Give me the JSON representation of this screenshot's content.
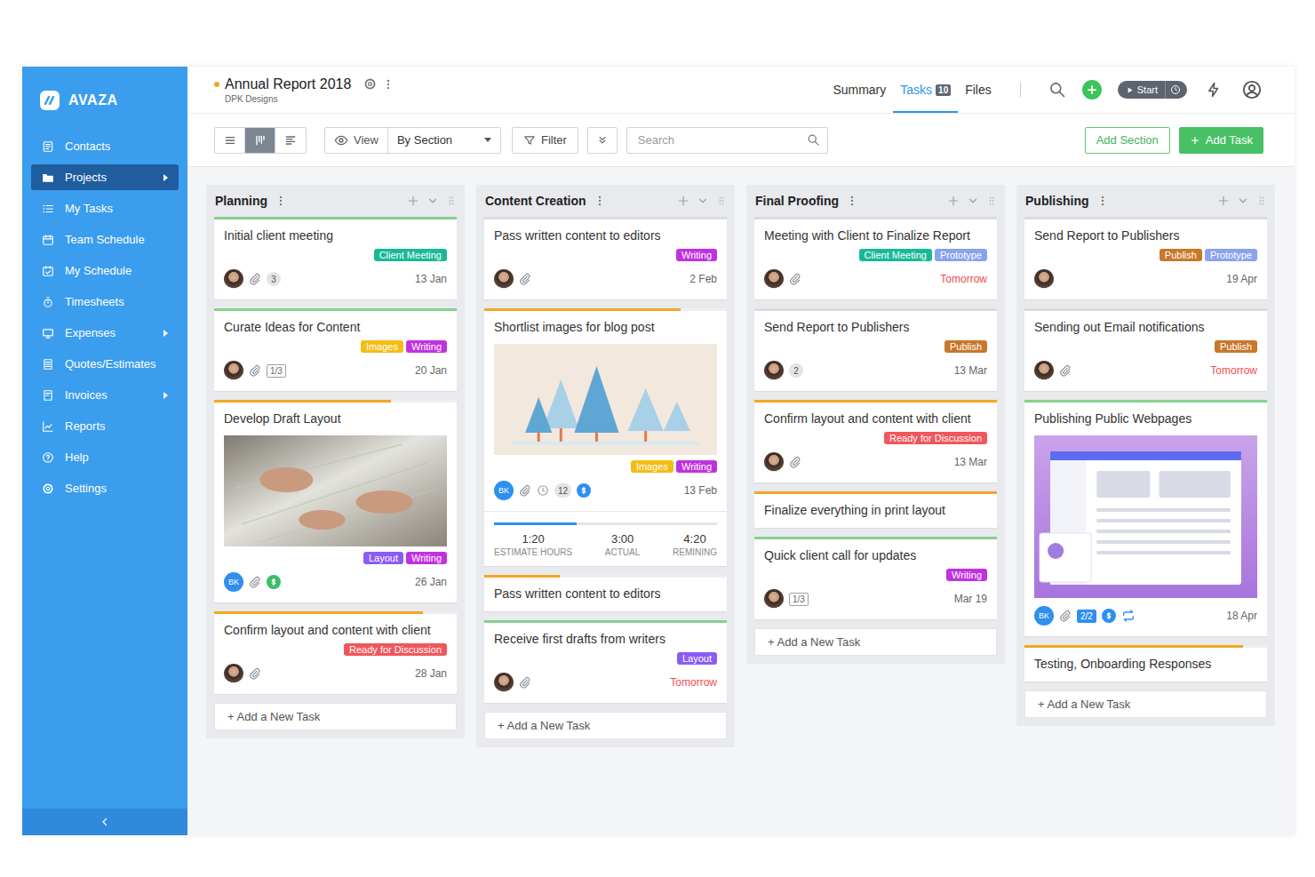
{
  "app": {
    "logo": "AVAZA"
  },
  "sidebar": {
    "items": [
      {
        "label": "Contacts",
        "selected": false,
        "has_submenu": false
      },
      {
        "label": "Projects",
        "selected": true,
        "has_submenu": true
      },
      {
        "label": "My Tasks",
        "selected": false,
        "has_submenu": false
      },
      {
        "label": "Team Schedule",
        "selected": false,
        "has_submenu": false
      },
      {
        "label": "My Schedule",
        "selected": false,
        "has_submenu": false
      },
      {
        "label": "Timesheets",
        "selected": false,
        "has_submenu": false
      },
      {
        "label": "Expenses",
        "selected": false,
        "has_submenu": true
      },
      {
        "label": "Quotes/Estimates",
        "selected": false,
        "has_submenu": false
      },
      {
        "label": "Invoices",
        "selected": false,
        "has_submenu": true
      },
      {
        "label": "Reports",
        "selected": false,
        "has_submenu": false
      },
      {
        "label": "Help",
        "selected": false,
        "has_submenu": false
      },
      {
        "label": "Settings",
        "selected": false,
        "has_submenu": false
      }
    ]
  },
  "project": {
    "title": "Annual Report 2018",
    "client": "DPK Designs",
    "status_color": "#f5a623"
  },
  "nav_tabs": [
    {
      "label": "Summary",
      "selected": false
    },
    {
      "label": "Tasks",
      "badge": "10",
      "selected": true
    },
    {
      "label": "Files",
      "selected": false
    }
  ],
  "timer": {
    "label": "Start"
  },
  "toolbar": {
    "view_modes": [
      {
        "selected": false
      },
      {
        "selected": true
      },
      {
        "selected": false
      }
    ],
    "view_label": "View",
    "group_by": "By Section",
    "filter": "Filter",
    "search_placeholder": "Search",
    "add_section": "Add Section",
    "add_task": "Add Task"
  },
  "columns": [
    {
      "title": "Planning",
      "add_task": "+ Add a New Task",
      "cards": [
        {
          "title": "Initial client meeting",
          "bar": {
            "color": "#86d08e",
            "level": 1
          },
          "tags": [
            {
              "label": "Client Meeting",
              "color": "#19b997"
            }
          ],
          "footer": {
            "avatar": {
              "kind": "photo"
            },
            "icons": [
              {
                "kind": "attachment"
              },
              {
                "kind": "count",
                "text": "3"
              }
            ],
            "date": {
              "text": "13 Jan",
              "color": "#666666"
            }
          }
        },
        {
          "title": "Curate Ideas for Content",
          "bar": {
            "color": "#86d08e",
            "level": 1
          },
          "tags": [
            {
              "label": "Images",
              "color": "#f5bd13"
            },
            {
              "label": "Writing",
              "color": "#c131e0"
            }
          ],
          "footer": {
            "avatar": {
              "kind": "photo"
            },
            "icons": [
              {
                "kind": "attachment"
              },
              {
                "kind": "checklist",
                "text": "1/3",
                "complete": false
              }
            ],
            "date": {
              "text": "20 Jan",
              "color": "#666666"
            }
          }
        },
        {
          "title": "Develop Draft Layout",
          "bar": {
            "color": "#f5a623",
            "level": 0.73
          },
          "media": "photo",
          "tags": [
            {
              "label": "Layout",
              "color": "#8a5cf6"
            },
            {
              "label": "Writing",
              "color": "#c131e0"
            }
          ],
          "footer": {
            "avatar": {
              "kind": "initials",
              "text": "BK"
            },
            "icons": [
              {
                "kind": "attachment"
              },
              {
                "kind": "dollar",
                "color": "#3dbb6b"
              }
            ],
            "date": {
              "text": "26 Jan",
              "color": "#666666"
            }
          }
        },
        {
          "title": "Confirm layout and content with client",
          "bar": {
            "color": "#f5a623",
            "level": 0.86
          },
          "tags": [
            {
              "label": "Ready for Discussion",
              "color": "#f0565b"
            }
          ],
          "footer": {
            "avatar": {
              "kind": "photo"
            },
            "icons": [
              {
                "kind": "attachment"
              }
            ],
            "date": {
              "text": "28 Jan",
              "color": "#666666"
            }
          }
        }
      ]
    },
    {
      "title": "Content Creation",
      "add_task": "+ Add a New Task",
      "cards": [
        {
          "title": "Pass written content to editors",
          "bar": {
            "color": "#d9dcdf",
            "level": 1
          },
          "tags": [
            {
              "label": "Writing",
              "color": "#c131e0"
            }
          ],
          "footer": {
            "avatar": {
              "kind": "photo"
            },
            "icons": [
              {
                "kind": "attachment"
              }
            ],
            "date": {
              "text": "2 Feb",
              "color": "#666666"
            }
          }
        },
        {
          "title": "Shortlist images for blog post",
          "bar": {
            "color": "#f5a623",
            "level": 0.81
          },
          "media": "illustration",
          "tags": [
            {
              "label": "Images",
              "color": "#f5bd13"
            },
            {
              "label": "Writing",
              "color": "#c131e0"
            }
          ],
          "footer": {
            "avatar": {
              "kind": "initials",
              "text": "BK"
            },
            "icons": [
              {
                "kind": "attachment"
              },
              {
                "kind": "clock"
              },
              {
                "kind": "count",
                "text": "12"
              },
              {
                "kind": "dollar",
                "color": "#2e8ff0"
              }
            ],
            "date": {
              "text": "13 Feb",
              "color": "#666666"
            }
          },
          "tracker": {
            "level": 0.37,
            "items": [
              {
                "value": "1:20",
                "label": "ESTIMATE HOURS"
              },
              {
                "value": "3:00",
                "label": "ACTUAL"
              },
              {
                "value": "4:20",
                "label": "REMINING"
              }
            ]
          }
        },
        {
          "title": "Pass written content to editors",
          "bar": {
            "color": "#f5a623",
            "level": 0.31
          },
          "tags": []
        },
        {
          "title": "Receive first drafts from writers",
          "bar": {
            "color": "#86d08e",
            "level": 1
          },
          "tags": [
            {
              "label": "Layout",
              "color": "#8a5cf6"
            }
          ],
          "footer": {
            "avatar": {
              "kind": "photo"
            },
            "icons": [
              {
                "kind": "attachment"
              }
            ],
            "date": {
              "text": "Tomorrow",
              "color": "#f04e4e"
            }
          }
        }
      ]
    },
    {
      "title": "Final Proofing",
      "add_task": "+ Add a New Task",
      "cards": [
        {
          "title": "Meeting with Client to Finalize Report",
          "bar": {
            "color": "#d9dcdf",
            "level": 1
          },
          "tags": [
            {
              "label": "Client Meeting",
              "color": "#19b997"
            },
            {
              "label": "Prototype",
              "color": "#8aa3ee"
            }
          ],
          "footer": {
            "avatar": {
              "kind": "photo"
            },
            "icons": [
              {
                "kind": "attachment"
              }
            ],
            "date": {
              "text": "Tomorrow",
              "color": "#f04e4e"
            }
          }
        },
        {
          "title": "Send Report to Publishers",
          "bar": {
            "color": "#d9dcdf",
            "level": 1
          },
          "tags": [
            {
              "label": "Publish",
              "color": "#c8782c"
            }
          ],
          "footer": {
            "avatar": {
              "kind": "photo"
            },
            "icons": [
              {
                "kind": "count",
                "text": "2"
              }
            ],
            "date": {
              "text": "13 Mar",
              "color": "#666666"
            }
          }
        },
        {
          "title": "Confirm layout and content with client",
          "bar": {
            "color": "#f5a623",
            "level": 1
          },
          "tags": [
            {
              "label": "Ready for Discussion",
              "color": "#f0565b"
            }
          ],
          "footer": {
            "avatar": {
              "kind": "photo"
            },
            "icons": [
              {
                "kind": "attachment"
              }
            ],
            "date": {
              "text": "13 Mar",
              "color": "#666666"
            }
          }
        },
        {
          "title": "Finalize everything in print layout",
          "bar": {
            "color": "#f5a623",
            "level": 1
          },
          "tags": []
        },
        {
          "title": "Quick client call for updates",
          "bar": {
            "color": "#86d08e",
            "level": 1
          },
          "tags": [
            {
              "label": "Writing",
              "color": "#c131e0"
            }
          ],
          "footer": {
            "avatar": {
              "kind": "photo"
            },
            "icons": [
              {
                "kind": "checklist",
                "text": "1/3",
                "complete": false
              }
            ],
            "date": {
              "text": "Mar 19",
              "color": "#666666"
            }
          }
        }
      ]
    },
    {
      "title": "Publishing",
      "add_task": "+ Add a New Task",
      "cards": [
        {
          "title": "Send Report to Publishers",
          "bar": {
            "color": "#d9dcdf",
            "level": 1
          },
          "tags": [
            {
              "label": "Publish",
              "color": "#c8782c"
            },
            {
              "label": "Prototype",
              "color": "#8aa3ee"
            }
          ],
          "footer": {
            "avatar": {
              "kind": "photo"
            },
            "icons": [],
            "date": {
              "text": "19 Apr",
              "color": "#666666"
            }
          }
        },
        {
          "title": "Sending out Email notifications",
          "bar": {
            "color": "#d9dcdf",
            "level": 1
          },
          "tags": [
            {
              "label": "Publish",
              "color": "#c8782c"
            }
          ],
          "footer": {
            "avatar": {
              "kind": "photo"
            },
            "icons": [
              {
                "kind": "attachment"
              }
            ],
            "date": {
              "text": "Tomorrow",
              "color": "#f04e4e"
            }
          }
        },
        {
          "title": "Publishing Public Webpages",
          "bar": {
            "color": "#86d08e",
            "level": 1
          },
          "media": "screenshot",
          "tags": [],
          "footer": {
            "avatar": {
              "kind": "initials",
              "text": "BK"
            },
            "icons": [
              {
                "kind": "attachment"
              },
              {
                "kind": "checklist",
                "text": "2/2",
                "complete": true
              },
              {
                "kind": "dollar",
                "color": "#2e8ff0"
              },
              {
                "kind": "repeat"
              }
            ],
            "date": {
              "text": "18 Apr",
              "color": "#666666"
            }
          }
        },
        {
          "title": "Testing, Onboarding Responses",
          "bar": {
            "color": "#f5a623",
            "level": 0.9
          },
          "tags": []
        }
      ]
    }
  ]
}
